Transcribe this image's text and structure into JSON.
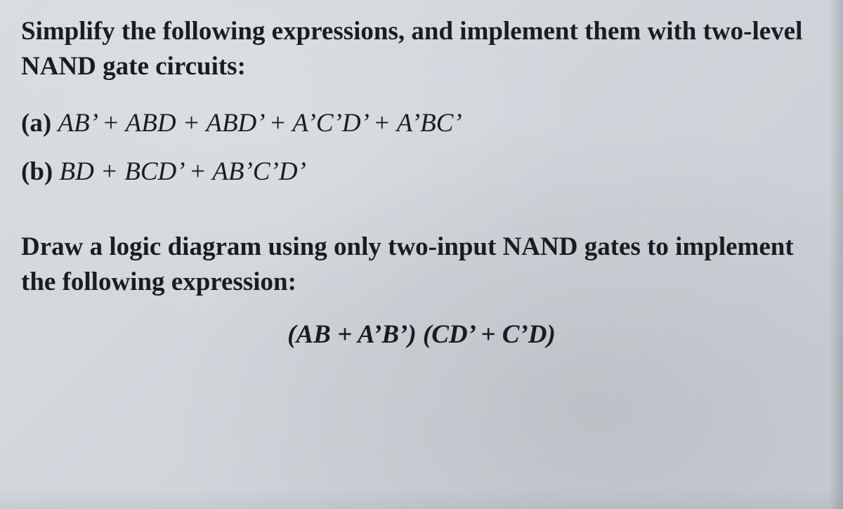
{
  "problem1": {
    "heading": "Simplify the following expressions, and implement them with two-level NAND gate circuits:",
    "items": [
      {
        "label": "(a)",
        "expr": "AB’ + ABD + ABD’ + A’C’D’ + A’BC’"
      },
      {
        "label": "(b)",
        "expr": "BD + BCD’ + AB’C’D’"
      }
    ]
  },
  "problem2": {
    "heading": "Draw a logic diagram using only two-input NAND gates to implement the following expression:",
    "expr": "(AB + A’B’) (CD’ + C’D)"
  }
}
